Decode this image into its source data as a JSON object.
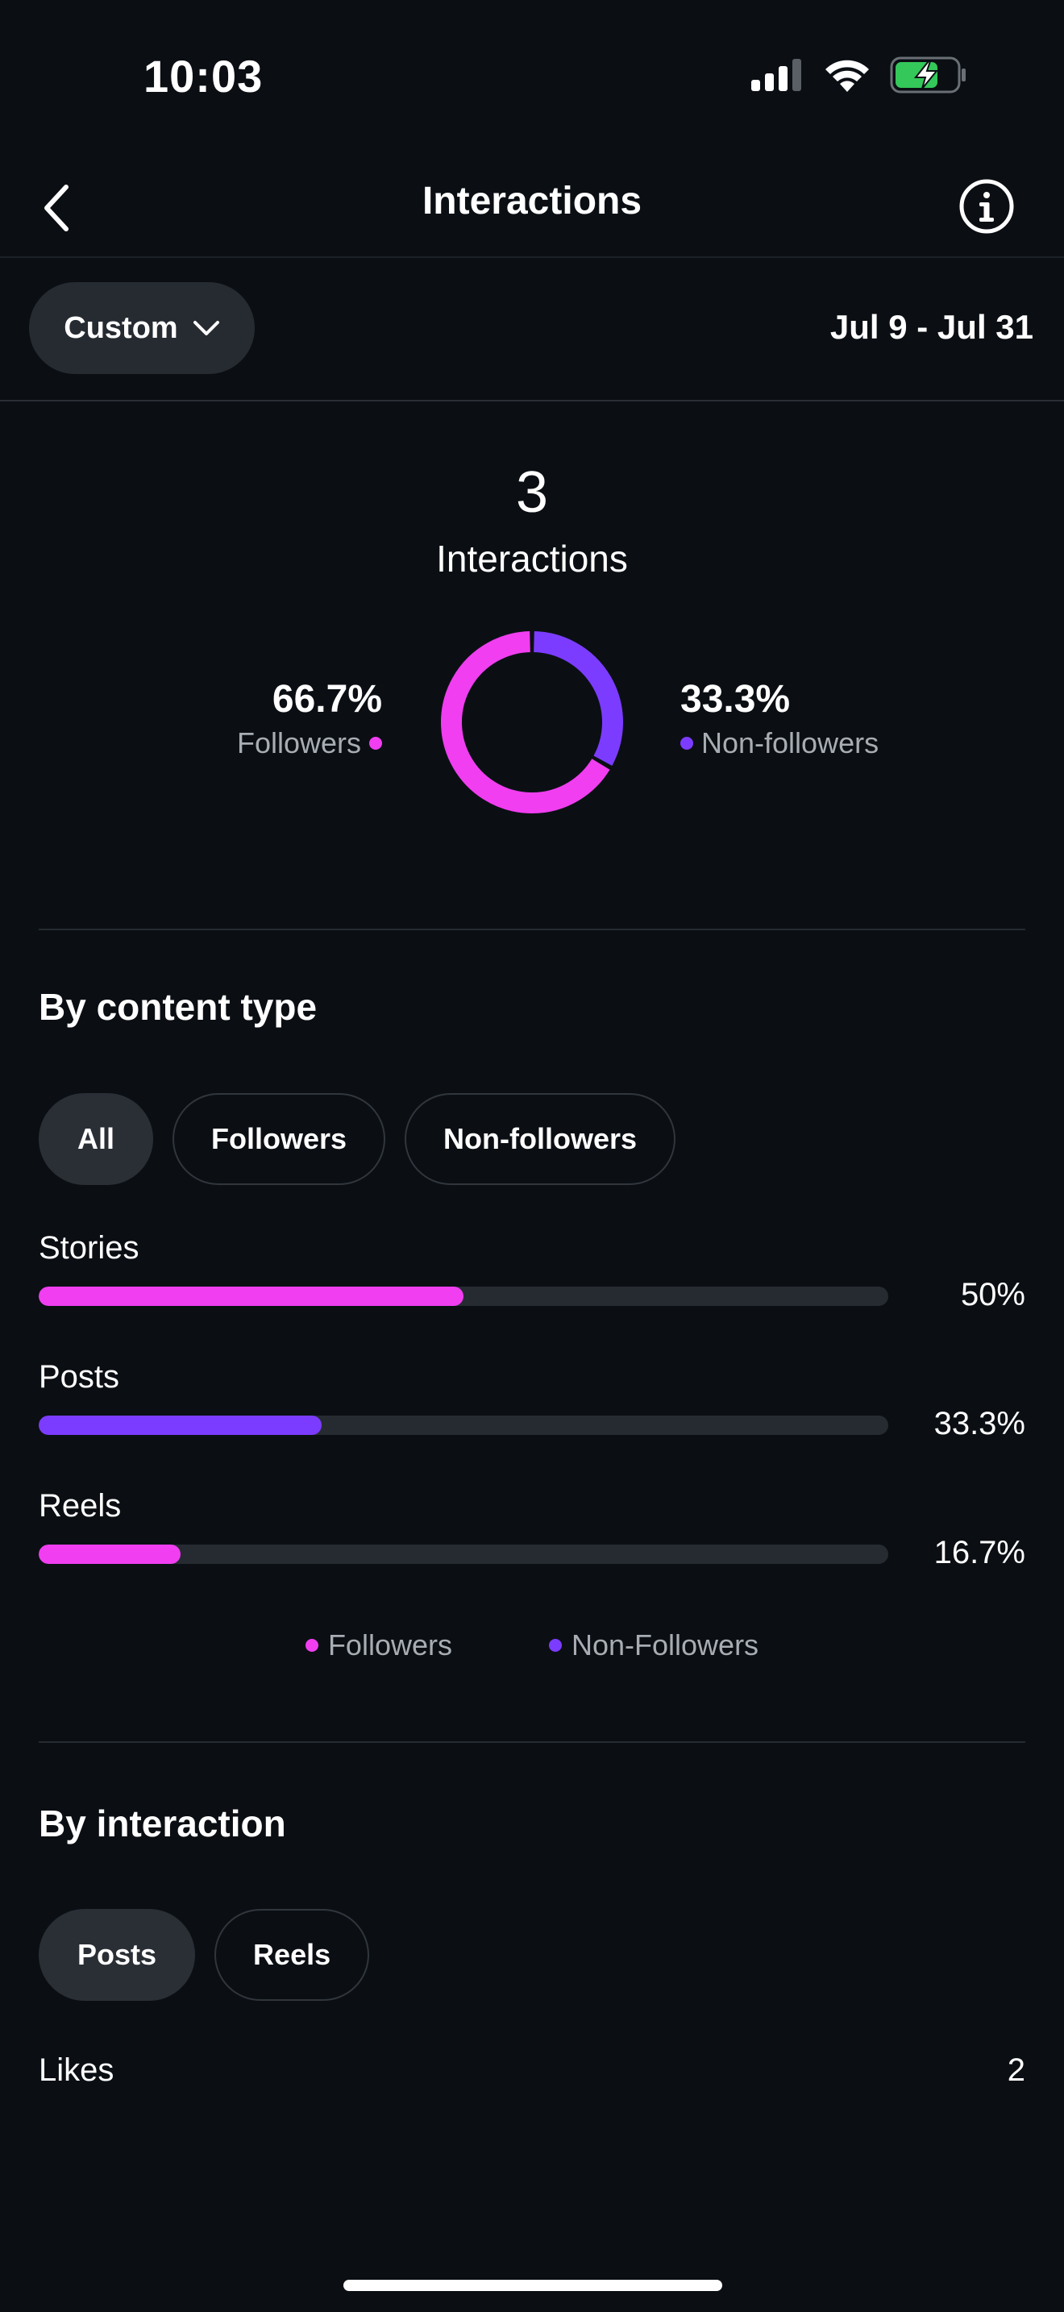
{
  "status_bar": {
    "time": "10:03",
    "icons": [
      "cellular-signal-icon",
      "wifi-icon",
      "battery-charging-icon"
    ],
    "battery_color": "#34c759"
  },
  "nav": {
    "title": "Interactions",
    "back_icon": "chevron-left-icon",
    "info_icon": "info-icon"
  },
  "filter": {
    "range_button_label": "Custom",
    "date_range": "Jul 9 - Jul 31"
  },
  "summary": {
    "total": "3",
    "total_label": "Interactions",
    "followers": {
      "percent": "66.7%",
      "label": "Followers",
      "color": "#f03ef0",
      "fraction": 0.667
    },
    "non_followers": {
      "percent": "33.3%",
      "label": "Non-followers",
      "color": "#7c3cff",
      "fraction": 0.333
    }
  },
  "content_type": {
    "title": "By content type",
    "filters": [
      {
        "label": "All",
        "active": true
      },
      {
        "label": "Followers",
        "active": false
      },
      {
        "label": "Non-followers",
        "active": false
      }
    ],
    "rows": [
      {
        "label": "Stories",
        "value_text": "50%",
        "fraction": 0.5,
        "color": "#f03ef0"
      },
      {
        "label": "Posts",
        "value_text": "33.3%",
        "fraction": 0.333,
        "color": "#7c3cff"
      },
      {
        "label": "Reels",
        "value_text": "16.7%",
        "fraction": 0.167,
        "color": "#f03ef0"
      }
    ],
    "legend": [
      {
        "label": "Followers",
        "color": "#f03ef0"
      },
      {
        "label": "Non-Followers",
        "color": "#7c3cff"
      }
    ]
  },
  "interaction": {
    "title": "By interaction",
    "tabs": [
      {
        "label": "Posts",
        "active": true
      },
      {
        "label": "Reels",
        "active": false
      }
    ],
    "rows": [
      {
        "label": "Likes",
        "value": "2"
      }
    ]
  }
}
